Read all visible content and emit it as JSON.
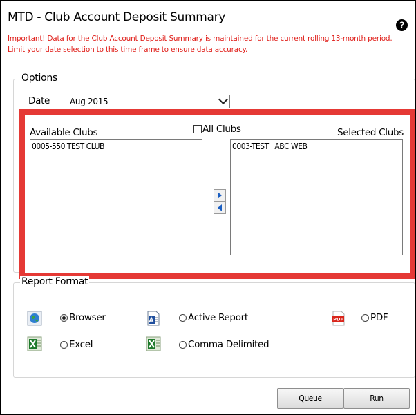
{
  "window": {
    "title": "MTD - Club Account Deposit Summary",
    "help_glyph": "?",
    "warning_line1": "Important! Data for the Club Account Deposit Summary is maintained for the current rolling 13-month period.",
    "warning_line2": "Limit your date selection to this time frame to ensure data accuracy."
  },
  "options": {
    "legend": "Options",
    "date_label": "Date",
    "date_value": "Aug 2015"
  },
  "clubs": {
    "available_label": "Available Clubs",
    "all_clubs_label": "All Clubs",
    "selected_label": "Selected Clubs",
    "available_items": [
      "0005-550 TEST CLUB"
    ],
    "selected_items": [
      "0003-TEST   ABC WEB"
    ],
    "highlight_color": "#e53935"
  },
  "report_format": {
    "legend": "Report Format",
    "options": [
      {
        "label": "Browser",
        "selected": true,
        "icon": "globe-icon"
      },
      {
        "label": "Active Report",
        "selected": false,
        "icon": "active-report-icon"
      },
      {
        "label": "PDF",
        "selected": false,
        "icon": "pdf-icon"
      },
      {
        "label": "Excel",
        "selected": false,
        "icon": "excel-icon"
      },
      {
        "label": "Comma Delimited",
        "selected": false,
        "icon": "excel-icon"
      }
    ]
  },
  "buttons": {
    "queue": "Queue",
    "run": "Run"
  }
}
